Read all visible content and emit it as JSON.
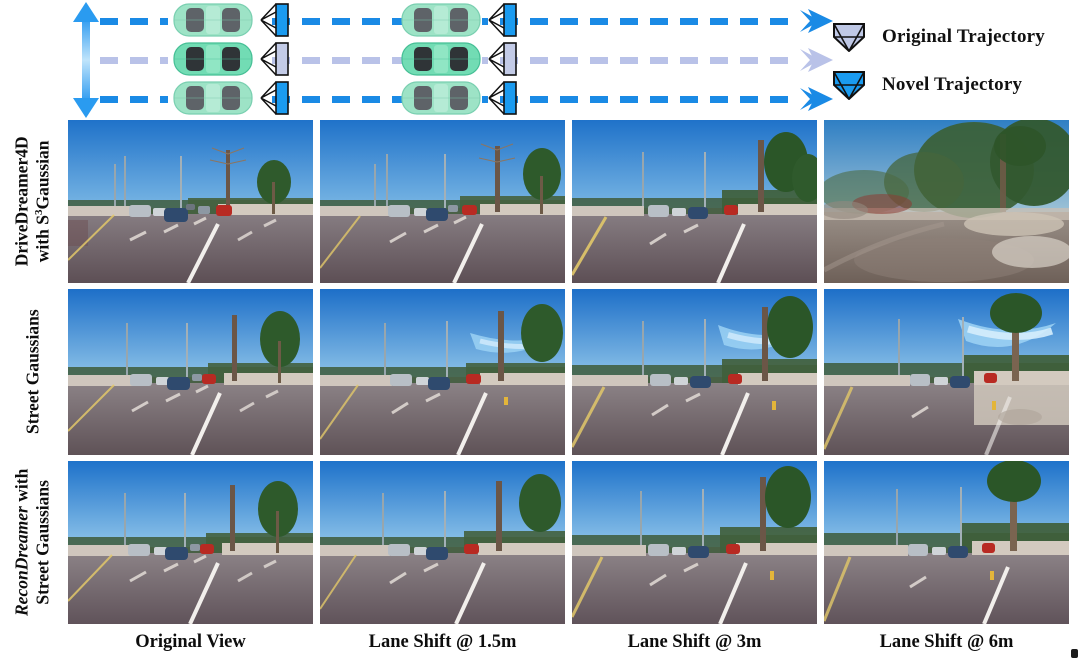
{
  "figure": {
    "diagram": {
      "vertical_arrow": {
        "name": "lane-shift-range-arrow",
        "color": "#2a9bf0"
      },
      "lanes": [
        {
          "id": "lane-top",
          "type": "novel",
          "line_color": "#1a8ae5",
          "camera_icon": "camera-frustum-novel"
        },
        {
          "id": "lane-middle",
          "type": "original",
          "line_color": "#b9c2e8",
          "camera_icon": "camera-frustum-original"
        },
        {
          "id": "lane-bottom",
          "type": "novel",
          "line_color": "#1a8ae5",
          "camera_icon": "camera-frustum-novel"
        }
      ],
      "car_color": "#9de3c6",
      "car_color_highlight": "#57d3a8",
      "car_icon": "car-top-view-icon",
      "car_positions": [
        180,
        408
      ]
    },
    "legend": {
      "items": [
        {
          "label": "Original Trajectory",
          "icon": "camera-frustum-icon",
          "fill": "#bfc8e6"
        },
        {
          "label": "Novel Trajectory",
          "icon": "camera-frustum-icon",
          "fill": "#1a9bf0"
        }
      ]
    },
    "row_labels": [
      {
        "name": "row-label-drivedreamer4d",
        "line1": "DriveDreamer4D",
        "line2_pre": "with S",
        "line2_sup": "3",
        "line2_post": "Gaussian",
        "italic_part": ""
      },
      {
        "name": "row-label-street-gaussians",
        "line1": "Street Gaussians",
        "line2_pre": "",
        "line2_sup": "",
        "line2_post": "",
        "italic_part": ""
      },
      {
        "name": "row-label-recondreamer",
        "line1_italic": "ReconDreamer",
        "line1_rest": " with",
        "line2_pre": "Street Gaussians",
        "line2_sup": "",
        "line2_post": "",
        "italic_part": "ReconDreamer"
      }
    ],
    "column_captions": [
      "Original View",
      "Lane Shift @ 1.5m",
      "Lane Shift @ 3m",
      "Lane Shift @ 6m"
    ],
    "grid": {
      "rows": 3,
      "cols": 4,
      "cells": [
        {
          "row": 0,
          "col": 0,
          "name": "cell-drivedreamer4d-original-view",
          "content": "driving-scene-straight-road"
        },
        {
          "row": 0,
          "col": 1,
          "name": "cell-drivedreamer4d-shift-1p5m",
          "content": "driving-scene-shift-1p5m"
        },
        {
          "row": 0,
          "col": 2,
          "name": "cell-drivedreamer4d-shift-3m",
          "content": "driving-scene-shift-3m"
        },
        {
          "row": 0,
          "col": 3,
          "name": "cell-drivedreamer4d-shift-6m",
          "content": "driving-scene-shift-6m-degraded"
        },
        {
          "row": 1,
          "col": 0,
          "name": "cell-street-gaussians-original-view",
          "content": "driving-scene-straight-road"
        },
        {
          "row": 1,
          "col": 1,
          "name": "cell-street-gaussians-shift-1p5m",
          "content": "driving-scene-shift-1p5m-artifact"
        },
        {
          "row": 1,
          "col": 2,
          "name": "cell-street-gaussians-shift-3m",
          "content": "driving-scene-shift-3m-artifact"
        },
        {
          "row": 1,
          "col": 3,
          "name": "cell-street-gaussians-shift-6m",
          "content": "driving-scene-shift-6m-artifact"
        },
        {
          "row": 2,
          "col": 0,
          "name": "cell-recondreamer-original-view",
          "content": "driving-scene-straight-road"
        },
        {
          "row": 2,
          "col": 1,
          "name": "cell-recondreamer-shift-1p5m",
          "content": "driving-scene-shift-1p5m-clean"
        },
        {
          "row": 2,
          "col": 2,
          "name": "cell-recondreamer-shift-3m",
          "content": "driving-scene-shift-3m-clean"
        },
        {
          "row": 2,
          "col": 3,
          "name": "cell-recondreamer-shift-6m",
          "content": "driving-scene-shift-6m-clean"
        }
      ]
    }
  }
}
